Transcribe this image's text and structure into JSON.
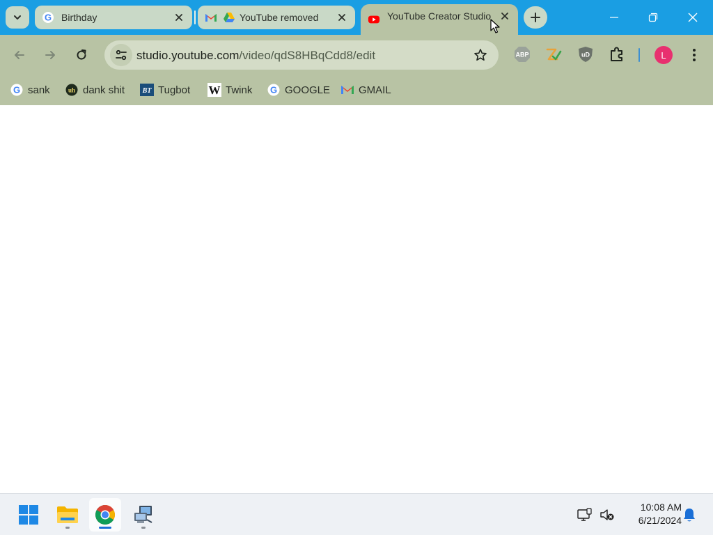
{
  "browser": {
    "tabs": [
      {
        "title": "Birthday",
        "favicon": "google-g-icon",
        "active": false
      },
      {
        "title": "YouTube removed",
        "favicon": "gmail-drive-icon",
        "active": false
      },
      {
        "title": "YouTube Creator Studio",
        "favicon": "youtube-icon",
        "active": true
      }
    ],
    "url": {
      "host": "studio.youtube.com",
      "path": "/video/qdS8HBqCdd8/edit"
    },
    "extensions": [
      {
        "name": "adblock-plus-icon",
        "label": "ABP"
      },
      {
        "name": "grammarly-check-icon"
      },
      {
        "name": "ublock-origin-icon",
        "label": "uD"
      },
      {
        "name": "extensions-puzzle-icon"
      }
    ],
    "profile_initial": "L",
    "bookmarks": [
      {
        "label": "sank",
        "icon": "google-g-icon"
      },
      {
        "label": "dank shit",
        "icon": "dank-shit-icon",
        "icon_text": "uh"
      },
      {
        "label": "Tugbot",
        "icon": "tugbot-icon",
        "icon_text": "BT"
      },
      {
        "label": "Twink",
        "icon": "wikipedia-w-icon",
        "icon_text": "W"
      },
      {
        "label": "GOOGLE",
        "icon": "google-g-icon"
      },
      {
        "label": "GMAIL",
        "icon": "gmail-icon"
      }
    ]
  },
  "taskbar": {
    "apps": [
      {
        "name": "windows-start-icon"
      },
      {
        "name": "file-explorer-icon"
      },
      {
        "name": "chrome-icon",
        "active": true
      },
      {
        "name": "network-computer-icon"
      }
    ],
    "time": "10:08 AM",
    "date": "6/21/2024"
  },
  "colors": {
    "tabstrip": "#1a9ee3",
    "toolbar": "#b8c3a4",
    "omnibox": "#d4dcc7",
    "inactive_tab": "#c9d9c7",
    "avatar": "#e8306f",
    "youtube_red": "#ff0000"
  }
}
